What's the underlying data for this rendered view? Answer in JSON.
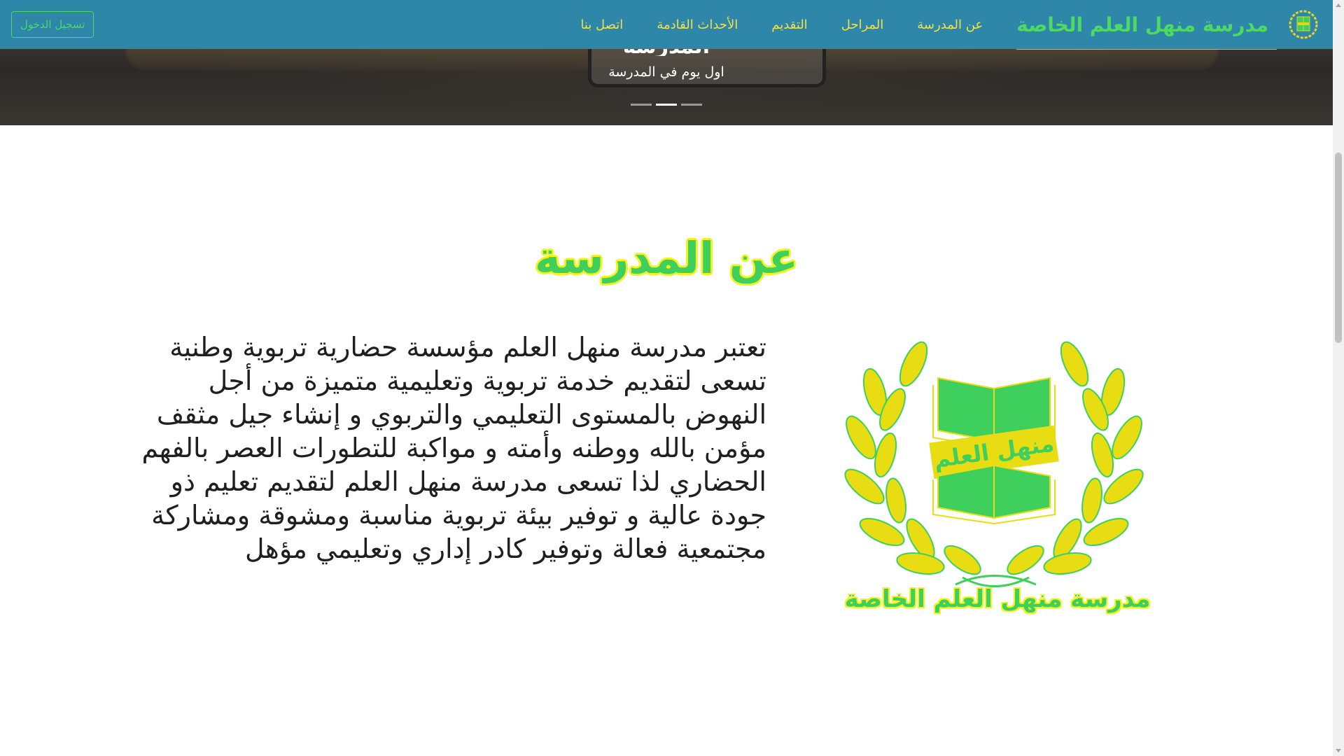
{
  "navbar": {
    "brand_name": "مدرسة منهل العلم الخاصة",
    "links": [
      {
        "label": "عن المدرسة"
      },
      {
        "label": "المراحل"
      },
      {
        "label": "التقديم"
      },
      {
        "label": "الأحداث القادمة"
      },
      {
        "label": "اتصل بنا"
      }
    ],
    "login_label": "تسجيل الدخول"
  },
  "hero": {
    "caption_title": "المدرسة",
    "caption_subtitle": "اول يوم في المدرسة",
    "slide_count": 3,
    "active_slide": 2
  },
  "about": {
    "title": "عن المدرسة",
    "text": "تعتبر مدرسة منهل العلم مؤسسة حضارية تربوية وطنية تسعى لتقديم خدمة تربوية وتعليمية متميزة من أجل النهوض بالمستوى التعليمي والتربوي و إنشاء جيل مثقف مؤمن بالله ووطنه وأمته و مواكبة للتطورات العصر بالفهم الحضاري لذا تسعى مدرسة منهل العلم لتقديم تعليم ذو جودة عالية و توفير بيئة تربوية مناسبة ومشوقة ومشاركة مجتمعية فعالة وتوفير كادر إداري وتعليمي مؤهل",
    "logo_book_text": "منهل العلم",
    "logo_name": "مدرسة منهل العلم الخاصة"
  },
  "colors": {
    "navbar_bg": "#2e86a8",
    "brand_green": "#4cd964",
    "nav_link_yellow": "#f2e14a",
    "title_green": "#3ecf5c",
    "title_outline_yellow": "#f4f21c"
  },
  "icons": {
    "brand_logo": "school-crest-icon",
    "about_logo": "laurel-book-icon"
  }
}
